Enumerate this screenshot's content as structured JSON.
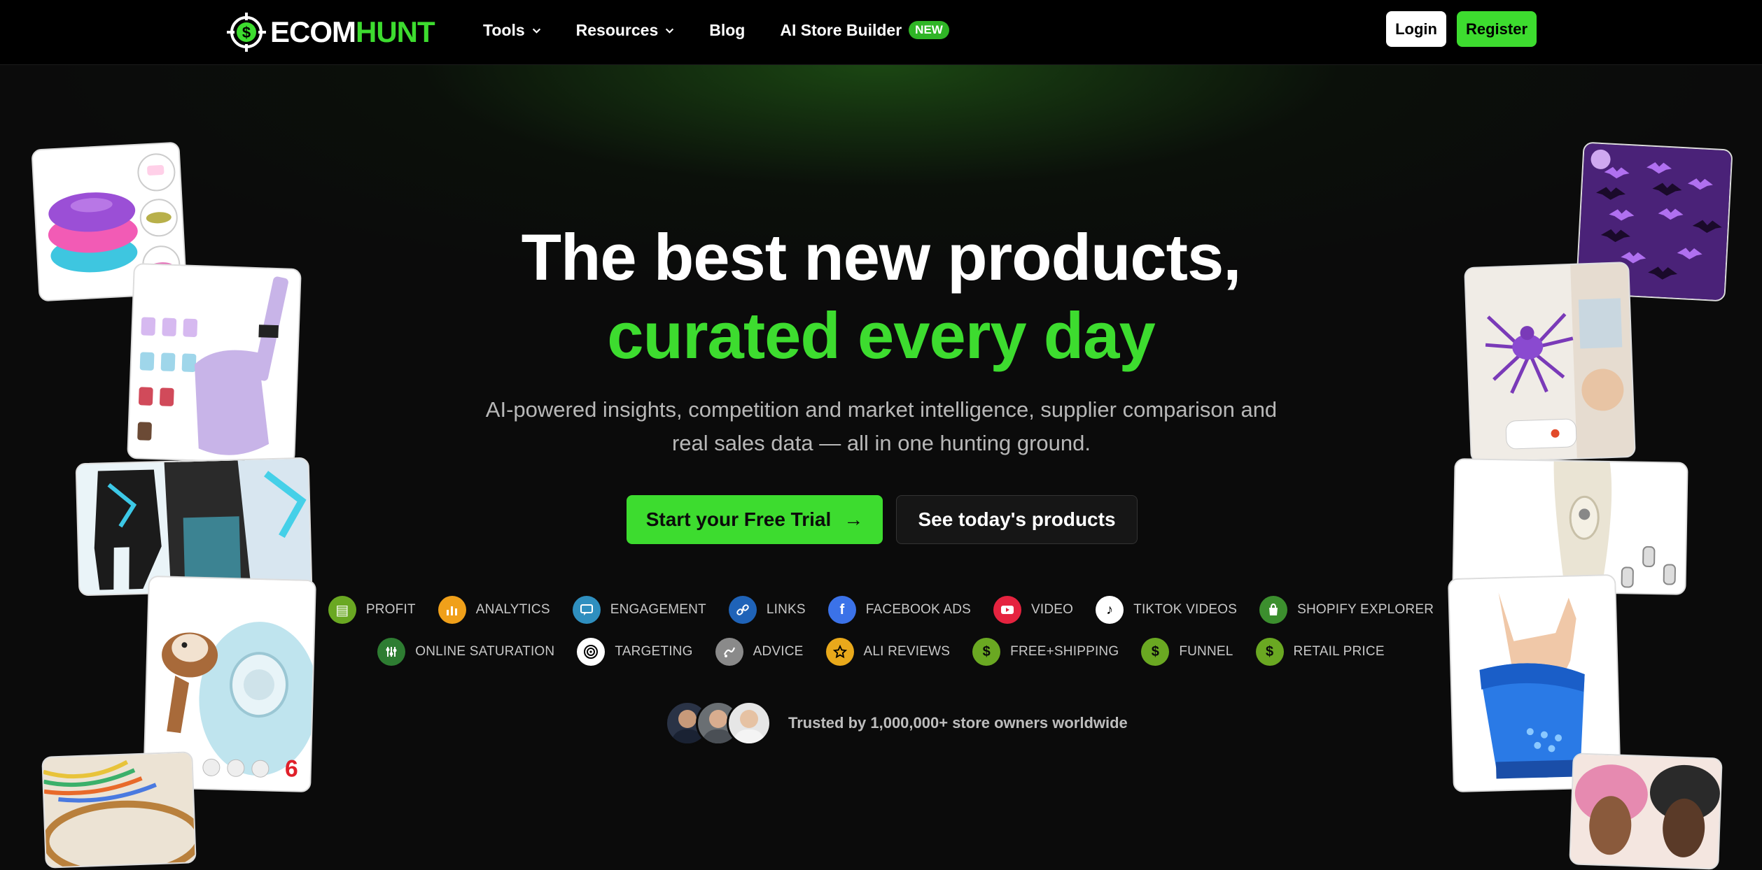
{
  "nav": {
    "logo_part1": "ECOM",
    "logo_part2": "HUNT",
    "links": [
      {
        "label": "Tools",
        "has_dropdown": true
      },
      {
        "label": "Resources",
        "has_dropdown": true
      },
      {
        "label": "Blog",
        "has_dropdown": false
      },
      {
        "label": "AI Store Builder",
        "badge": "NEW"
      }
    ],
    "login_label": "Login",
    "register_label": "Register"
  },
  "hero": {
    "headline_line1": "The best new products,",
    "headline_line2": "curated every day",
    "subtext": "AI-powered insights, competition and market intelligence, supplier comparison and real sales data — all in one hunting ground.",
    "cta_primary": "Start your Free Trial",
    "cta_secondary": "See today's products"
  },
  "features": {
    "row1": [
      {
        "label": "PROFIT",
        "icon": "profit-icon",
        "color": "#6aa822"
      },
      {
        "label": "ANALYTICS",
        "icon": "analytics-icon",
        "color": "#f0a01a"
      },
      {
        "label": "ENGAGEMENT",
        "icon": "engagement-icon",
        "color": "#2f8fbf"
      },
      {
        "label": "LINKS",
        "icon": "link-icon",
        "color": "#1f63b8"
      },
      {
        "label": "FACEBOOK ADS",
        "icon": "facebook-icon",
        "color": "#3b72e8"
      },
      {
        "label": "VIDEO",
        "icon": "youtube-icon",
        "color": "#e5233f"
      },
      {
        "label": "TIKTOK VIDEOS",
        "icon": "tiktok-icon",
        "color": "#ffffff"
      },
      {
        "label": "SHOPIFY EXPLORER",
        "icon": "shopify-icon",
        "color": "#3c8f2e"
      }
    ],
    "row2": [
      {
        "label": "ONLINE SATURATION",
        "icon": "saturation-icon",
        "color": "#2e7d32"
      },
      {
        "label": "TARGETING",
        "icon": "target-icon",
        "color": "#ffffff"
      },
      {
        "label": "ADVICE",
        "icon": "advice-icon",
        "color": "#8a8a8a"
      },
      {
        "label": "ALI REVIEWS",
        "icon": "star-icon",
        "color": "#e9a91b"
      },
      {
        "label": "FREE+SHIPPING",
        "icon": "dollar-icon",
        "color": "#6aa822"
      },
      {
        "label": "FUNNEL",
        "icon": "dollar-icon",
        "color": "#6aa822"
      },
      {
        "label": "RETAIL PRICE",
        "icon": "dollar-icon",
        "color": "#6aa822"
      }
    ]
  },
  "trust": {
    "text": "Trusted by 1,000,000+ store owners worldwide"
  },
  "colors": {
    "brand_green": "#3ddc2f",
    "background": "#0b0b0b"
  }
}
